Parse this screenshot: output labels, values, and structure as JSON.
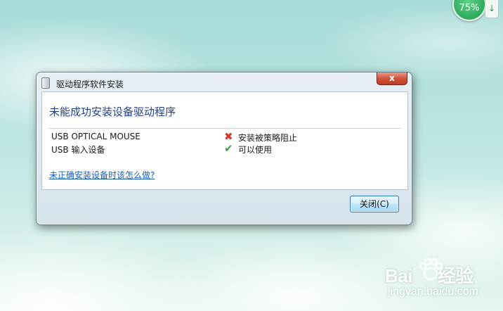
{
  "indicator": {
    "percent_label": "75%",
    "tab_arrow": "↓"
  },
  "dialog": {
    "title": "驱动程序软件安装",
    "close_glyph": "x",
    "heading": "未能成功安装设备驱动程序",
    "devices": [
      {
        "name": "USB OPTICAL MOUSE",
        "status": "安装被策略阻止",
        "status_icon": "red-x-icon",
        "icon_glyph": "✖"
      },
      {
        "name": "USB 输入设备",
        "status": "可以使用",
        "status_icon": "green-check-icon",
        "icon_glyph": "✔"
      }
    ],
    "help_link": "未正确安装设备时该怎么做?",
    "close_button": "关闭(C)"
  },
  "watermark": {
    "brand_left": "Bai",
    "brand_right": "经验",
    "sub": "jingyan.baidu.com"
  },
  "colors": {
    "heading": "#1f3f8f",
    "link": "#1a5fb4",
    "error": "#d23a2a",
    "ok": "#3c9d3b"
  }
}
